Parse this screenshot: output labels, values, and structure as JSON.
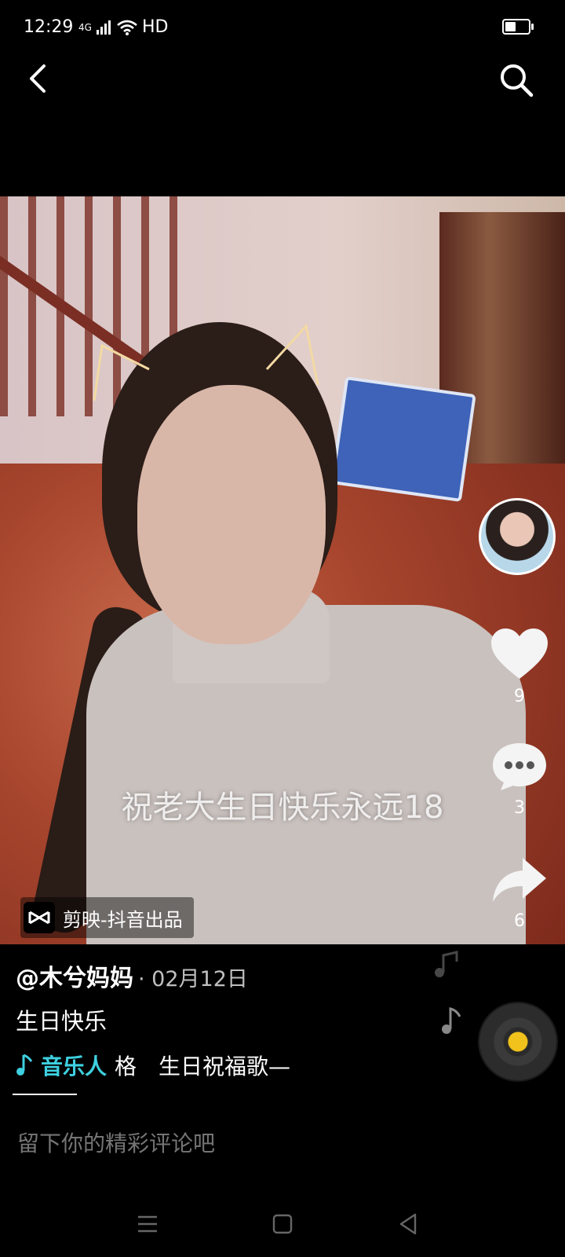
{
  "status_bar": {
    "time": "12:29",
    "network": "4G",
    "extra": "HD"
  },
  "video": {
    "caption": "祝老大生日快乐永远18",
    "watermark": "剪映-抖音出品"
  },
  "actions": {
    "likes": "9",
    "comments": "3",
    "shares": "6"
  },
  "post": {
    "author": "@木兮妈妈",
    "date": "· 02月12日",
    "description": "生日快乐",
    "music_artist": "音乐人",
    "music_title": "格　生日祝福歌—"
  },
  "comment": {
    "placeholder": "留下你的精彩评论吧"
  },
  "colors": {
    "accent": "#3ed0e0",
    "disc_center": "#f1c21b"
  },
  "icons": [
    "back-icon",
    "search-icon",
    "heart-icon",
    "comment-icon",
    "share-icon",
    "music-note-icon",
    "music-disc-icon",
    "capcut-icon",
    "nav-menu-icon",
    "nav-home-icon",
    "nav-back-icon"
  ]
}
